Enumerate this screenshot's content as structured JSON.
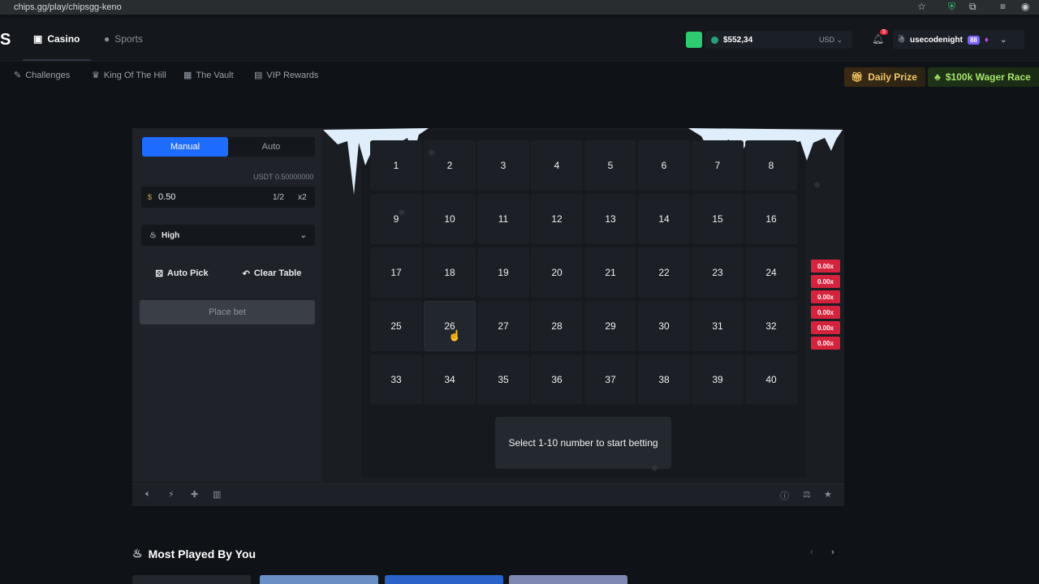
{
  "browser": {
    "url": "chips.gg/play/chipsgg-keno"
  },
  "nav": {
    "logo": "S",
    "tabs": [
      {
        "label": "Casino"
      },
      {
        "label": "Sports"
      }
    ],
    "balance": "$552,34",
    "currency": "USD",
    "notifications": "5",
    "username": "usecodenight",
    "level": "88"
  },
  "subnav": {
    "items": [
      {
        "label": "Challenges"
      },
      {
        "label": "King Of The Hill"
      },
      {
        "label": "The Vault"
      },
      {
        "label": "VIP Rewards"
      }
    ],
    "daily_prize": "Daily Prize",
    "wager_race": "$100k Wager Race"
  },
  "controls": {
    "mode_manual": "Manual",
    "mode_auto": "Auto",
    "balance_label": "USDT 0.50000000",
    "bet_amount": "0.50",
    "half": "1/2",
    "double": "x2",
    "risk": "High",
    "auto_pick": "Auto Pick",
    "clear_table": "Clear Table",
    "place_bet": "Place bet"
  },
  "board": {
    "numbers": [
      "1",
      "2",
      "3",
      "4",
      "5",
      "6",
      "7",
      "8",
      "9",
      "10",
      "11",
      "12",
      "13",
      "14",
      "15",
      "16",
      "17",
      "18",
      "19",
      "20",
      "21",
      "22",
      "23",
      "24",
      "25",
      "26",
      "27",
      "28",
      "29",
      "30",
      "31",
      "32",
      "33",
      "34",
      "35",
      "36",
      "37",
      "38",
      "39",
      "40"
    ],
    "payouts": [
      "0.00x",
      "0.00x",
      "0.00x",
      "0.00x",
      "0.00x",
      "0.00x"
    ],
    "prompt": "Select 1-10 number to start betting"
  },
  "footer": {
    "most_played": "Most Played By You"
  },
  "colors": {
    "accent_blue": "#1e6cff",
    "payout_red": "#d6233d",
    "wallet_green": "#2ecc71"
  }
}
